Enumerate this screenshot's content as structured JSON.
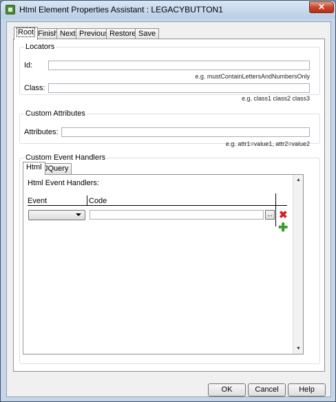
{
  "window": {
    "title": "Html Element Properties Assistant : LEGACYBUTTON1",
    "close_glyph": "✕"
  },
  "tabs": [
    "Root",
    "Finish",
    "Next",
    "Previous",
    "Restore",
    "Save"
  ],
  "active_tab": "Root",
  "locators": {
    "legend": "Locators",
    "id_label": "Id:",
    "id_value": "",
    "id_hint": "e.g. mustContainLettersAndNumbersOnly",
    "class_label": "Class:",
    "class_value": "",
    "class_hint": "e.g. class1 class2 class3"
  },
  "custom_attributes": {
    "legend": "Custom Attributes",
    "label": "Attributes:",
    "value": "",
    "hint": "e.g. attr1=value1, attr2=value2"
  },
  "event_handlers": {
    "legend": "Custom Event Handlers",
    "tabs": [
      "Html",
      "JQuery"
    ],
    "active_tab": "Html",
    "caption": "Html Event Handlers:",
    "columns": [
      "Event",
      "Code"
    ],
    "row": {
      "event": "",
      "code": "",
      "ellipsis": "..."
    },
    "delete_icon": "delete-icon",
    "add_icon": "add-icon",
    "delete_glyph": "✖",
    "add_glyph": "✚"
  },
  "buttons": {
    "ok": "OK",
    "cancel": "Cancel",
    "help": "Help"
  }
}
